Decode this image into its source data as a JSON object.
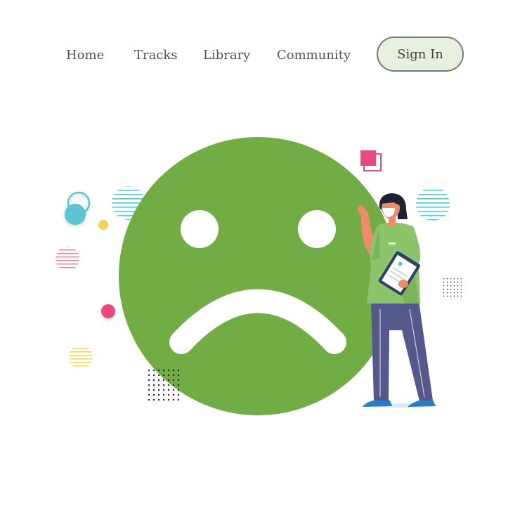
{
  "nav": {
    "items": [
      {
        "label": "Home"
      },
      {
        "label": "Tracks"
      },
      {
        "label": "Library"
      },
      {
        "label": "Community"
      }
    ],
    "signin_label": "Sign In"
  },
  "hero": {
    "illustration": "sad-face-with-healthcare-worker",
    "colors": {
      "face": "#71ad44",
      "accent_pink": "#e84a7f",
      "accent_teal": "#5bc4d4",
      "accent_yellow": "#f5d34f",
      "scrubs_top": "#8cc46c",
      "scrubs_pants": "#54588a",
      "nav_text": "#555555",
      "signin_bg": "#e8f1de"
    }
  }
}
